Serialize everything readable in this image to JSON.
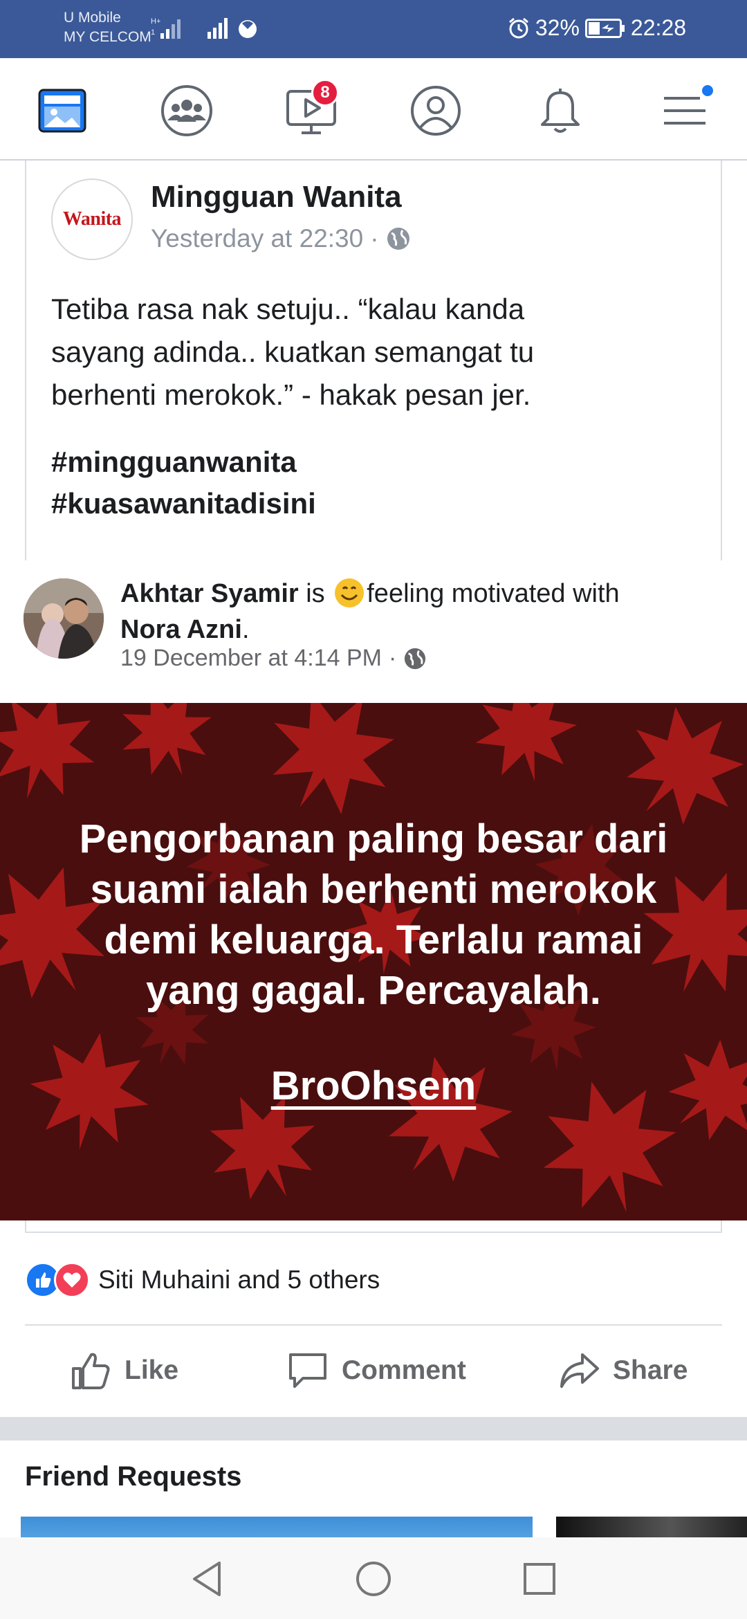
{
  "status_bar": {
    "carrier_line1": "U Mobile",
    "carrier_line2": "MY CELCOM",
    "battery": "32%",
    "time": "22:28"
  },
  "nav": {
    "items": [
      {
        "name": "news-feed-icon",
        "active": true
      },
      {
        "name": "groups-icon"
      },
      {
        "name": "watch-icon",
        "badge": "8"
      },
      {
        "name": "profile-icon"
      },
      {
        "name": "notifications-icon"
      },
      {
        "name": "menu-icon",
        "dot": true
      }
    ]
  },
  "post1": {
    "logo_text": "Wanita",
    "author": "Mingguan Wanita",
    "time": "Yesterday at 22:30",
    "text_lines": [
      "Tetiba rasa nak setuju.. “kalau kanda",
      "sayang adinda.. kuatkan semangat tu",
      "berhenti merokok.” - hakak pesan jer."
    ],
    "hashtags": [
      "#mingguanwanita",
      "#kuasawanitadisini"
    ]
  },
  "post2": {
    "author": "Akhtar Syamir",
    "is_text": "is",
    "feeling": "feeling motivated with",
    "tagged": "Nora Azni",
    "period": ".",
    "time": "19 December at 4:14 PM",
    "image_lines": [
      "Pengorbanan paling besar dari",
      "suami ialah berhenti merokok",
      "demi keluarga. Terlalu ramai",
      "yang gagal. Percayalah."
    ],
    "image_signature": "BroOhsem",
    "reactions_text": "Siti Muhaini and 5 others",
    "actions": {
      "like": "Like",
      "comment": "Comment",
      "share": "Share"
    }
  },
  "friend_requests": {
    "title": "Friend Requests"
  },
  "colors": {
    "brand": "#3b5998",
    "accent": "#1877f2",
    "badge": "#e41e3f",
    "image_bg": "#5a1212"
  }
}
